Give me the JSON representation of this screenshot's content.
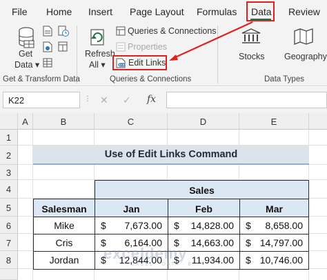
{
  "ribbon_tabs": [
    "File",
    "Home",
    "Insert",
    "Page Layout",
    "Formulas",
    "Data",
    "Review"
  ],
  "active_tab": "Data",
  "ribbon": {
    "get_data": {
      "line1": "Get",
      "line2": "Data ▾"
    },
    "refresh_all": {
      "line1": "Refresh",
      "line2": "All ▾"
    },
    "queries_connections": "Queries & Connections",
    "properties": "Properties",
    "edit_links": "Edit Links",
    "stocks": "Stocks",
    "geography": "Geography",
    "group_labels": {
      "get_transform": "Get & Transform Data",
      "queries": "Queries & Connections",
      "data_types": "Data Types"
    }
  },
  "formula_bar": {
    "name_box": "K22",
    "cancel_icon": "✕",
    "enter_icon": "✓",
    "fx_label": "fx",
    "formula": ""
  },
  "sheet": {
    "columns": [
      "A",
      "B",
      "C",
      "D",
      "E"
    ],
    "rows": [
      "1",
      "2",
      "3",
      "4",
      "5",
      "6",
      "7",
      "8"
    ],
    "title": "Use of Edit Links Command",
    "sales_header": "Sales",
    "col_headers": [
      "Salesman",
      "Jan",
      "Feb",
      "Mar"
    ],
    "records": [
      {
        "name": "Mike",
        "jan": "7,673.00",
        "feb": "14,828.00",
        "mar": "8,658.00"
      },
      {
        "name": "Cris",
        "jan": "6,164.00",
        "feb": "14,663.00",
        "mar": "14,797.00"
      },
      {
        "name": "Jordan",
        "jan": "12,844.00",
        "feb": "11,934.00",
        "mar": "10,746.00"
      }
    ],
    "currency": "$"
  },
  "watermark": {
    "main": "exceldemy",
    "sub": "EXCEL · DATA · BI"
  },
  "colors": {
    "accent_red": "#e0201c",
    "excel_green": "#217346",
    "header_fill": "#dbe7f3",
    "title_fill": "#dde3ea"
  }
}
